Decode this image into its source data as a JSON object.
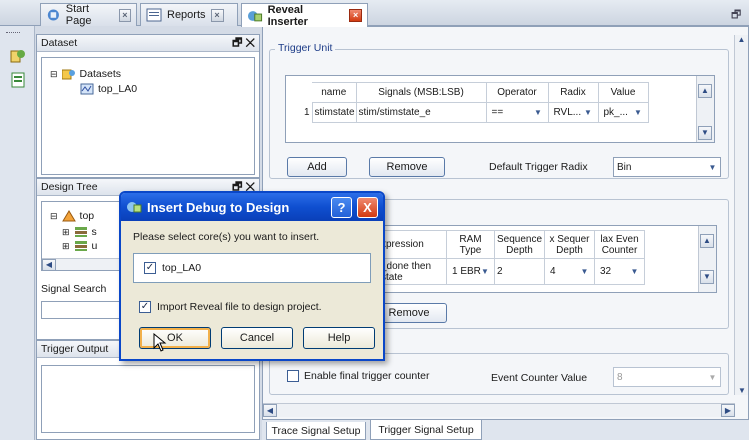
{
  "tabs": [
    {
      "label": "Start Page"
    },
    {
      "label": "Reports"
    },
    {
      "label": "Reveal Inserter"
    }
  ],
  "dataset_panel": {
    "title": "Dataset",
    "tree": {
      "root": "Datasets",
      "child": "top_LA0"
    }
  },
  "design_tree_panel": {
    "title": "Design Tree",
    "tree": {
      "root": "top",
      "children": [
        "s",
        "u"
      ]
    }
  },
  "signal_search": {
    "label": "Signal Search",
    "value": ""
  },
  "trigger_output": {
    "title": "Trigger Output"
  },
  "trigger_unit": {
    "group_label": "Trigger Unit",
    "columns": [
      "name",
      "Signals (MSB:LSB)",
      "Operator",
      "Radix",
      "Value"
    ],
    "rows": [
      {
        "index": "1",
        "name": "stimstate",
        "signals": "stim/stimstate_e",
        "operator": "==",
        "radix": "RVL...",
        "value": "pk_..."
      }
    ],
    "add_label": "Add",
    "remove_label": "Remove",
    "default_radix_label": "Default Trigger Radix",
    "default_radix_value": "Bin"
  },
  "trigger_expression": {
    "columns": [
      "xpression",
      "RAM Type",
      "Sequence Depth",
      "x Sequer Depth",
      "lax Even Counter"
    ],
    "row": {
      "expression": "_done then state",
      "ram_type": "1 EBR",
      "sequence_depth": "2",
      "max_sequence_depth": "4",
      "max_event_counter": "32"
    },
    "remove_label": "Remove"
  },
  "final_counter": {
    "enable_label": "Enable final trigger counter",
    "event_counter_label": "Event Counter Value",
    "event_counter_value": "8"
  },
  "bottom_tabs": [
    {
      "label": "Trace Signal Setup"
    },
    {
      "label": "Trigger Signal Setup"
    }
  ],
  "dialog": {
    "title": "Insert Debug to Design",
    "prompt": "Please select core(s) you want to insert.",
    "core_label": "top_LA0",
    "core_checked": true,
    "import_label": "Import Reveal file to design project.",
    "import_checked": true,
    "ok_label": "OK",
    "cancel_label": "Cancel",
    "help_label": "Help",
    "help_btn": "?",
    "close_btn": "X"
  },
  "colors": {
    "title_blue": "#0f4fd0",
    "group_label": "#1d3c88",
    "close_red": "#d23a10"
  }
}
